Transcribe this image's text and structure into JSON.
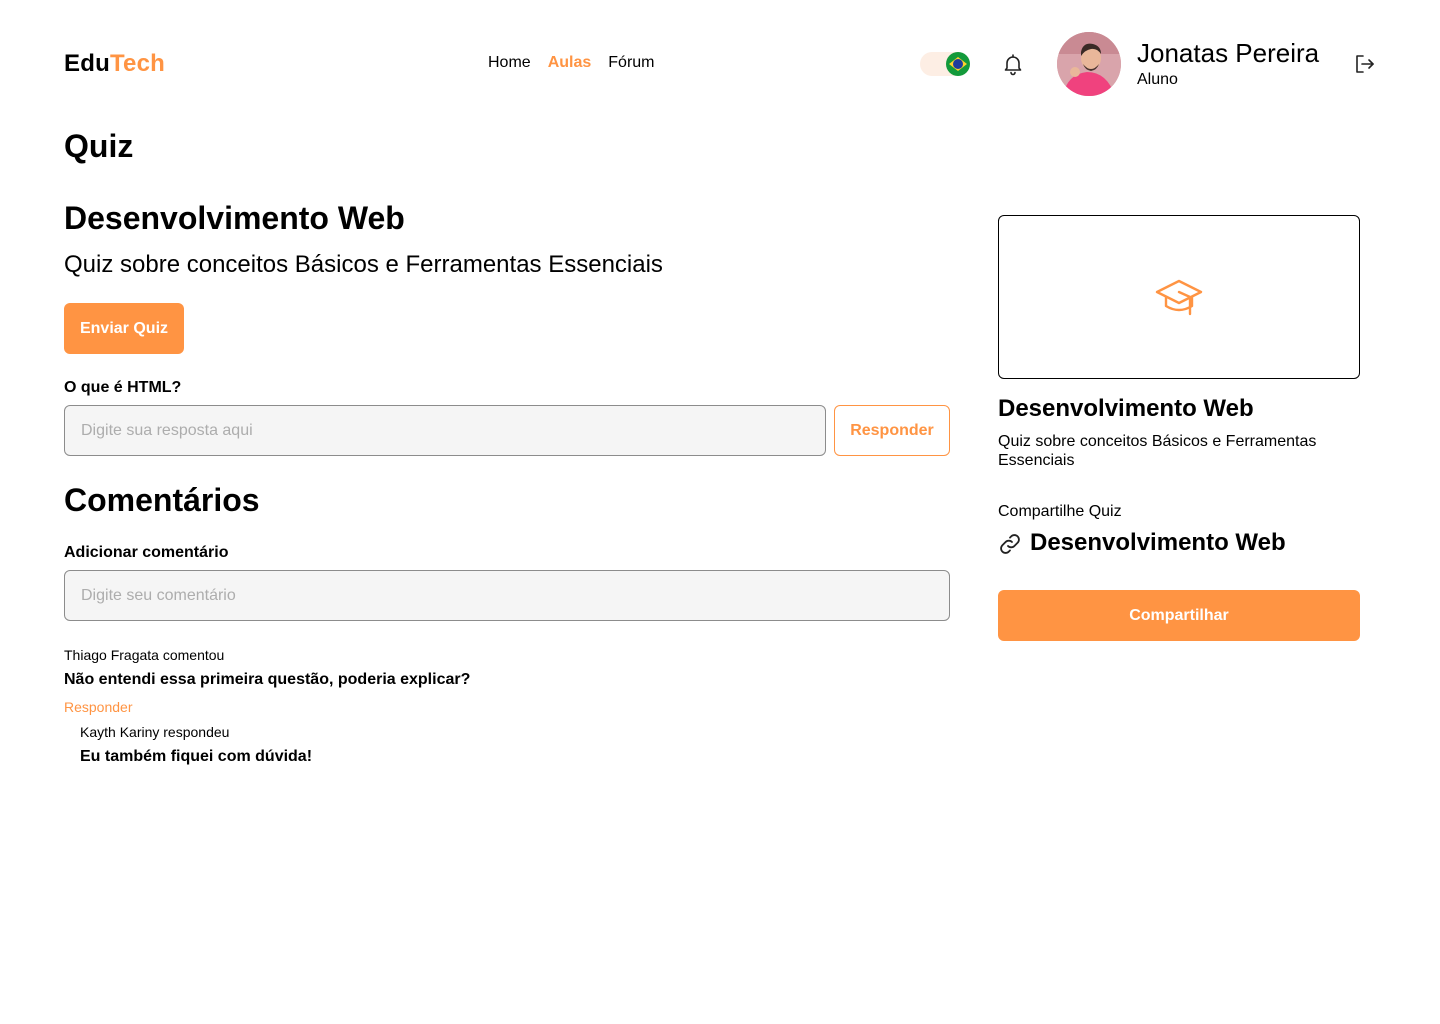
{
  "header": {
    "logo_part1": "Edu",
    "logo_part2": "Tech",
    "nav": [
      {
        "label": "Home",
        "active": false
      },
      {
        "label": "Aulas",
        "active": true
      },
      {
        "label": "Fórum",
        "active": false
      }
    ],
    "language_icon": "brazil-flag-icon",
    "notifications_icon": "bell-icon",
    "logout_icon": "logout-icon",
    "user": {
      "name": "Jonatas Pereira",
      "role": "Aluno"
    }
  },
  "main": {
    "page_title": "Quiz",
    "course_title": "Desenvolvimento Web",
    "course_subtitle": "Quiz sobre conceitos Básicos e Ferramentas Essenciais",
    "send_button": "Enviar Quiz",
    "question": "O que é HTML?",
    "answer_placeholder": "Digite sua resposta aqui",
    "answer_button": "Responder"
  },
  "comments": {
    "title": "Comentários",
    "add_label": "Adicionar comentário",
    "placeholder": "Digite seu comentário",
    "items": [
      {
        "author": "Thiago Fragata comentou",
        "text": "Não entendi essa primeira questão, poderia explicar?",
        "reply_link": "Responder",
        "replies": [
          {
            "author": "Kayth Kariny respondeu",
            "text": "Eu também fiquei com dúvida!"
          }
        ]
      }
    ]
  },
  "sidebar": {
    "thumbnail_icon": "graduation-cap-icon",
    "title": "Desenvolvimento Web",
    "subtitle": "Quiz sobre conceitos Básicos e Ferramentas Essenciais",
    "share_label": "Compartilhe Quiz",
    "share_course": "Desenvolvimento Web",
    "share_button": "Compartilhar"
  },
  "colors": {
    "accent": "#ff9443",
    "input_bg": "#f5f5f5",
    "border": "#8c8c8c"
  }
}
